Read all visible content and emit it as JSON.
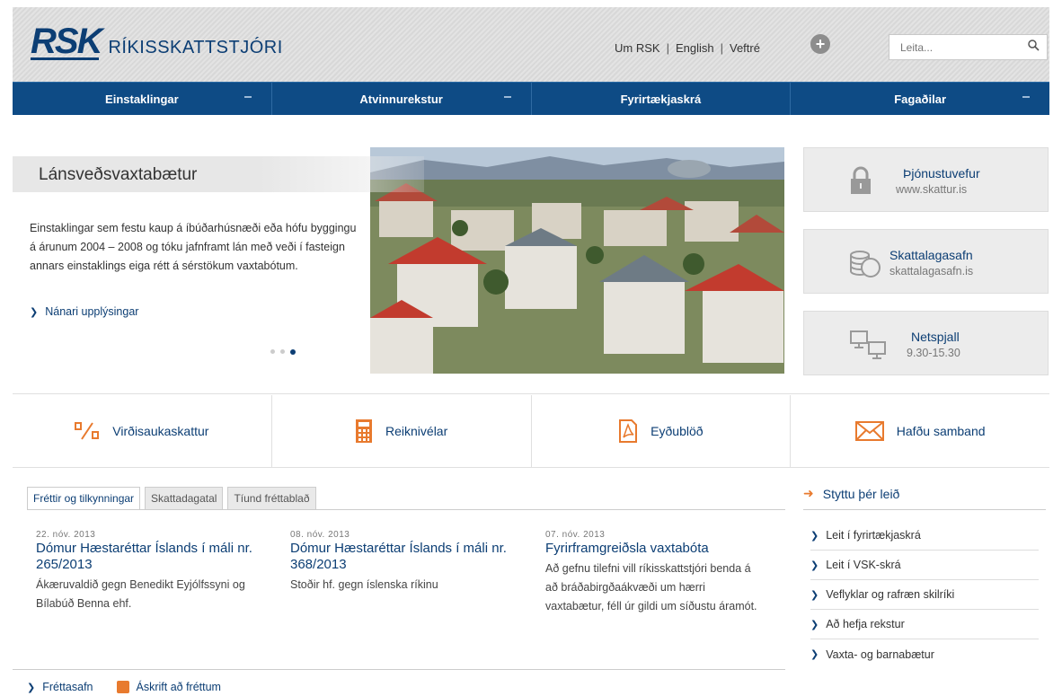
{
  "header": {
    "logo_mark": "RSK",
    "logo_text": "RÍKISSKATTSTJÓRI",
    "links": [
      "Um RSK",
      "English",
      "Veftré"
    ],
    "search_placeholder": "Leita..."
  },
  "nav": [
    "Einstaklingar",
    "Atvinnurekstur",
    "Fyrirtækjaskrá",
    "Fagaðilar"
  ],
  "hero": {
    "title": "Lánsveðsvaxtabætur",
    "text": "Einstaklingar sem festu kaup á íbúðarhúsnæði eða hófu byggingu á árunum 2004 – 2008 og tóku jafnframt lán með veði í fasteign annars einstaklings eiga rétt á sérstökum vaxtabótum.",
    "link": "Nánari upplýsingar",
    "dots": 3,
    "active_dot": 3
  },
  "side_boxes": [
    {
      "title": "Þjónustuvefur",
      "sub": "www.skattur.is",
      "icon": "lock-icon"
    },
    {
      "title": "Skattalagasafn",
      "sub": "skattalagasafn.is",
      "icon": "database-icon"
    },
    {
      "title": "Netspjall",
      "sub": "9.30-15.30",
      "icon": "computers-icon"
    }
  ],
  "quick_links": [
    {
      "label": "Virðisaukaskattur",
      "icon": "percent-icon"
    },
    {
      "label": "Reiknivélar",
      "icon": "calculator-icon"
    },
    {
      "label": "Eyðublöð",
      "icon": "pdf-icon"
    },
    {
      "label": "Hafðu samband",
      "icon": "envelope-icon"
    }
  ],
  "tabs": [
    "Fréttir og tilkynningar",
    "Skattadagatal",
    "Tíund fréttablað"
  ],
  "news": [
    {
      "date": "22. nóv. 2013",
      "title": "Dómur Hæstaréttar Íslands í máli nr. 265/2013",
      "desc": "Ákæruvaldið gegn Benedikt Eyjólfssyni og Bílabúð Benna ehf."
    },
    {
      "date": "08. nóv. 2013",
      "title": "Dómur Hæstaréttar Íslands í máli nr. 368/2013",
      "desc": "Stoðir hf. gegn íslenska ríkinu"
    },
    {
      "date": "07. nóv. 2013",
      "title": "Fyrirframgreiðsla vaxtabóta",
      "desc": "Að gefnu tilefni vill ríkisskattstjóri benda á að bráðabirgðaákvæði um hærri vaxtabætur, féll úr gildi um síðustu áramót."
    }
  ],
  "shortcuts": {
    "heading": "Styttu þér leið",
    "items": [
      "Leit í fyrirtækjaskrá",
      "Leit í VSK-skrá",
      "Veflyklar og rafræn skilríki",
      "Að hefja rekstur",
      "Vaxta- og barnabætur"
    ]
  },
  "footer": {
    "archive": "Fréttasafn",
    "subscribe": "Áskrift að fréttum"
  },
  "colors": {
    "brand": "#0c3e74",
    "nav": "#0e4b85",
    "accent": "#e87a2e"
  }
}
